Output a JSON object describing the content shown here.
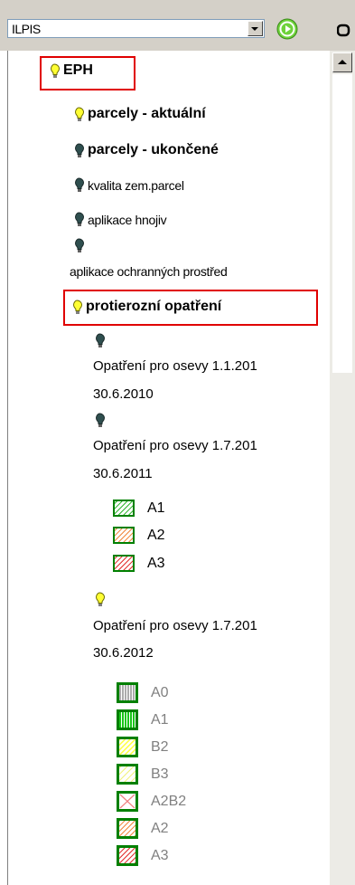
{
  "toolbar": {
    "layer_select": "ILPIS"
  },
  "tree": {
    "root": {
      "label": "EPH"
    },
    "layers": [
      {
        "label": "parcely - aktuální"
      },
      {
        "label": "parcely - ukončené"
      },
      {
        "label": "kvalita zem.parcel"
      },
      {
        "label": "aplikace hnojiv"
      },
      {
        "label": "aplikace ochranných prostřed"
      }
    ],
    "group": {
      "label": "protierozní opatření",
      "children": [
        {
          "line1": "Opatření pro osevy 1.1.201",
          "line2": "30.6.2010"
        },
        {
          "line1": "Opatření pro osevy 1.7.201",
          "line2": "30.6.2011",
          "legend": [
            "A1",
            "A2",
            "A3"
          ]
        },
        {
          "line1": "Opatření pro osevy 1.7.201",
          "line2": "30.6.2012",
          "legend": [
            "A0",
            "A1",
            "B2",
            "B3",
            "A2B2",
            "A2",
            "A3"
          ]
        }
      ]
    }
  },
  "colors": {
    "highlight_box": "#e00000",
    "bulb_on": "#ffff33",
    "bulb_off": "#2f4f4f",
    "legend_border": "#008000"
  }
}
